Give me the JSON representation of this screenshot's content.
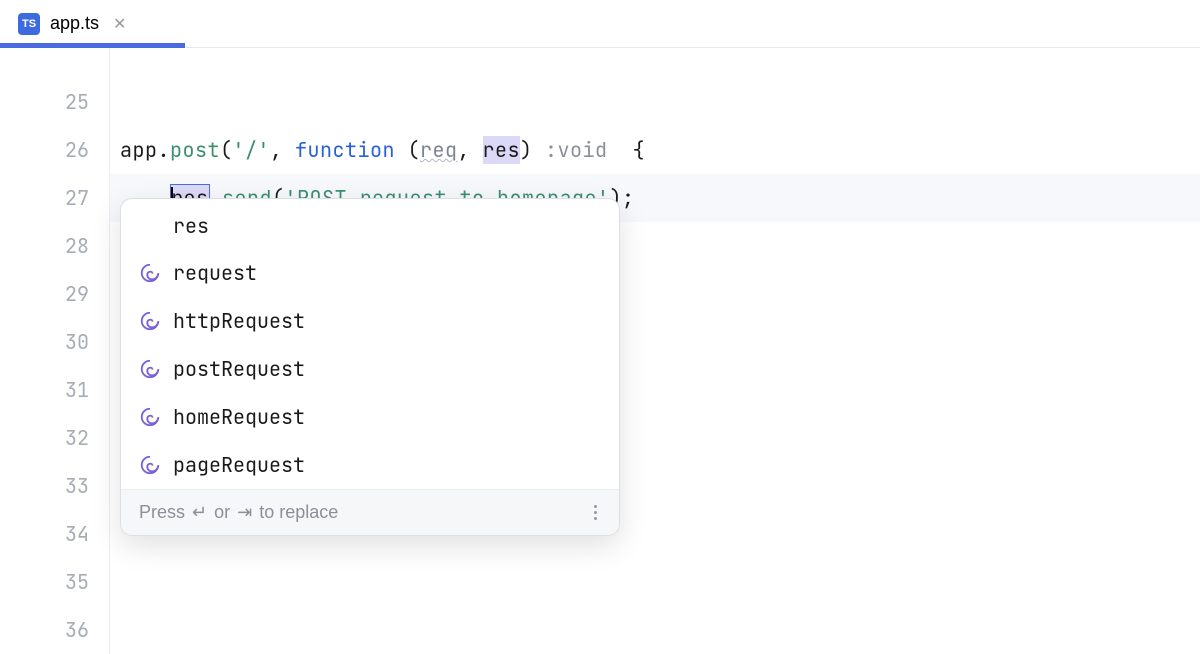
{
  "tab": {
    "icon_text": "TS",
    "filename": "app.ts"
  },
  "gutter": {
    "start": 25,
    "end": 36
  },
  "code": {
    "line26": {
      "app": "app",
      "dot1": ".",
      "post": "post",
      "open_paren": "(",
      "str_route": "'/'",
      "comma1": ", ",
      "function_kw": "function",
      "space1": " ",
      "open_paren2": "(",
      "req": "req",
      "comma2": ", ",
      "res": "res",
      "close_paren2": ")",
      "space2": " ",
      "colon": ":",
      "return_type": "void ",
      "space3": " ",
      "brace": "{"
    },
    "line27": {
      "indent": "    ",
      "res": "res",
      "dot": ".",
      "send": "send",
      "open_paren": "(",
      "str": "'POST request to homepage'",
      "close": ");"
    }
  },
  "popup": {
    "items": [
      {
        "label": "res",
        "has_icon": false
      },
      {
        "label": "request",
        "has_icon": true
      },
      {
        "label": "httpRequest",
        "has_icon": true
      },
      {
        "label": "postRequest",
        "has_icon": true
      },
      {
        "label": "homeRequest",
        "has_icon": true
      },
      {
        "label": "pageRequest",
        "has_icon": true
      }
    ],
    "hint_prefix": "Press ",
    "hint_key1": "↵",
    "hint_mid": " or ",
    "hint_key2": "⇥",
    "hint_suffix": " to replace"
  }
}
